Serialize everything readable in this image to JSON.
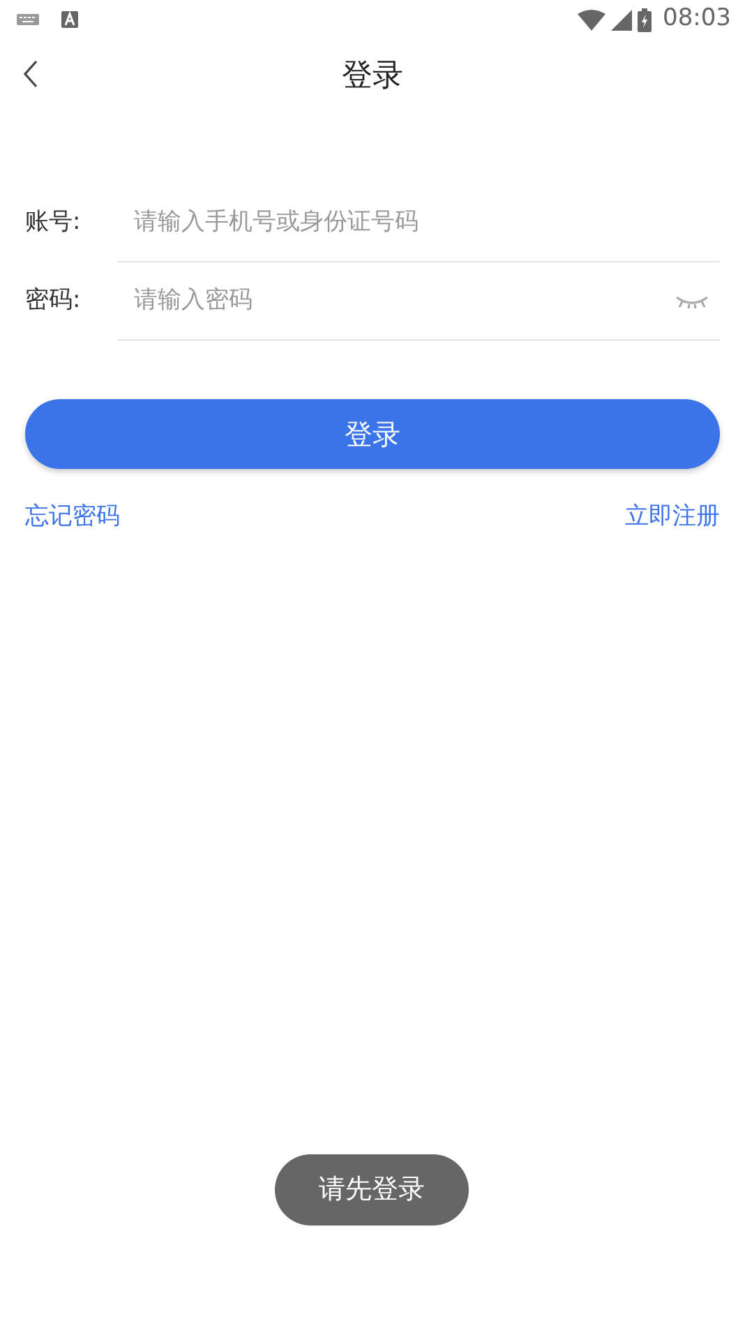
{
  "status_bar": {
    "time": "08:03"
  },
  "header": {
    "title": "登录"
  },
  "fields": [
    {
      "label": "账号:",
      "placeholder": "请输入手机号或身份证号码",
      "kind": "text"
    },
    {
      "label": "密码:",
      "placeholder": "请输入密码",
      "kind": "password"
    }
  ],
  "login_button": "登录",
  "links": [
    "忘记密码",
    "立即注册"
  ],
  "toast": "请先登录"
}
